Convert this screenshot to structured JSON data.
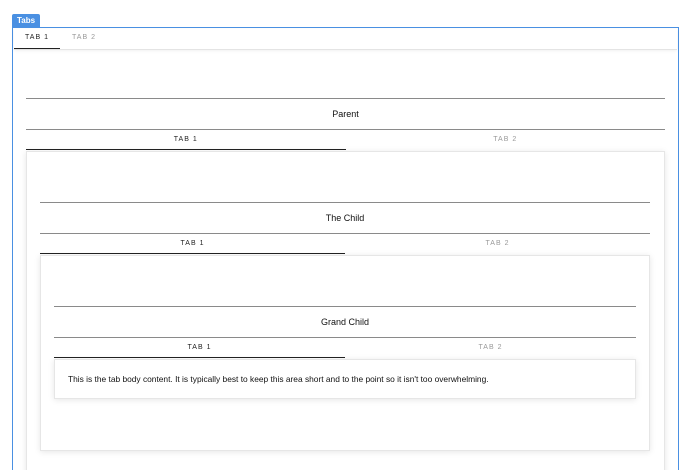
{
  "frame": {
    "badge": "Tabs"
  },
  "outer_tabs": [
    {
      "label": "TAB 1",
      "active": true
    },
    {
      "label": "TAB 2",
      "active": false
    }
  ],
  "parent": {
    "title": "Parent",
    "tabs": [
      {
        "label": "TAB 1",
        "active": true
      },
      {
        "label": "TAB 2",
        "active": false
      }
    ]
  },
  "child": {
    "title": "The Child",
    "tabs": [
      {
        "label": "TAB 1",
        "active": true
      },
      {
        "label": "TAB 2",
        "active": false
      }
    ]
  },
  "grandchild": {
    "title": "Grand Child",
    "tabs": [
      {
        "label": "TAB 1",
        "active": true
      },
      {
        "label": "TAB 2",
        "active": false
      }
    ],
    "body": "This is the tab body content. It is typically best to keep this area short and to the point so it isn't too overwhelming."
  },
  "colors": {
    "accent": "#4a90e2",
    "active_tab_text": "#222222",
    "inactive_tab_text": "#999999"
  }
}
